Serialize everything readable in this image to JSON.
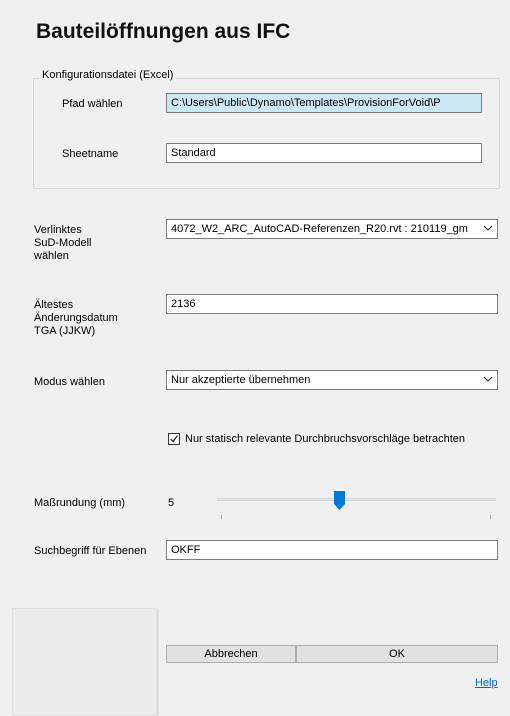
{
  "title": "Bauteilöffnungen aus IFC",
  "config_group": {
    "legend": "Konfigurationsdatei (Excel)",
    "path_label": "Pfad wählen",
    "path_value": "C:\\Users\\Public\\Dynamo\\Templates\\ProvisionForVoid\\P",
    "sheet_label": "Sheetname",
    "sheet_value": "Standard"
  },
  "linked_model": {
    "label_line1": "Verlinktes",
    "label_line2": "SuD-Modell",
    "label_line3": "wählen",
    "selected": "4072_W2_ARC_AutoCAD-Referenzen_R20.rvt : 210119_gm"
  },
  "change_date": {
    "label_line1": "Ältestes",
    "label_line2": "Änderungsdatum",
    "label_line3": "TGA (JJKW)",
    "value": "2136"
  },
  "mode": {
    "label": "Modus wählen",
    "selected": "Nur akzeptierte übernehmen"
  },
  "static_check": {
    "label": "Nur statisch relevante Durchbruchsvorschläge betrachten",
    "checked": true
  },
  "rounding": {
    "label": "Maßrundung (mm)",
    "value": "5",
    "slider_fraction": 0.44
  },
  "level_search": {
    "label": "Suchbegriff für Ebenen",
    "value": "OKFF"
  },
  "buttons": {
    "cancel": "Abbrechen",
    "ok": "OK",
    "help": "Help"
  },
  "colors": {
    "accent": "#0078d7",
    "selection": "#cce8f4",
    "link": "#0066cc"
  }
}
